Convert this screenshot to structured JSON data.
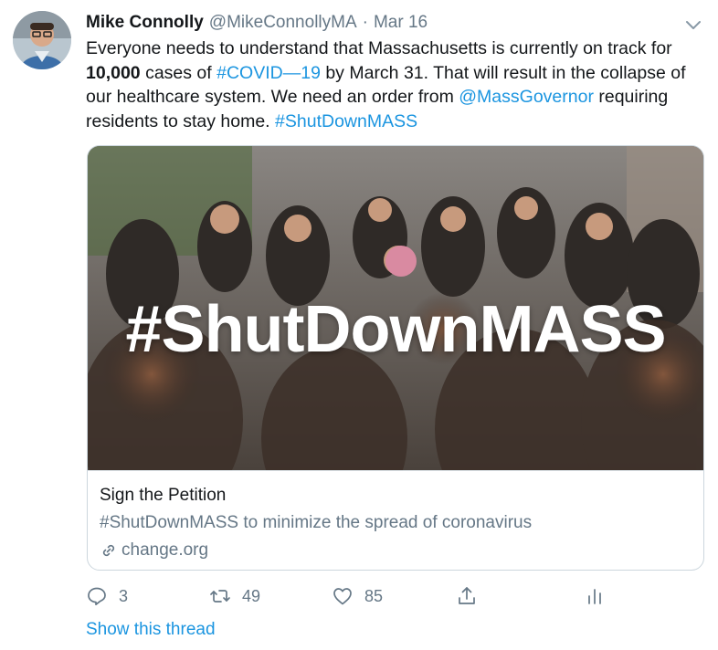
{
  "author": {
    "name": "Mike Connolly",
    "handle": "@MikeConnollyMA",
    "separator": "·",
    "date": "Mar 16",
    "avatar_icon": "avatar-photo"
  },
  "tweet": {
    "t1": "Everyone needs to understand that Massachusetts is currently on track for ",
    "bold": "10,000",
    "t2": " cases of ",
    "hashtag_covid": "#COVID—19",
    "t3": " by March 31. That will result in the collapse of our healthcare system. We need an order from ",
    "mention": "@MassGovernor",
    "t4": " requiring residents to stay home. ",
    "hashtag_shutdown": "#ShutDownMASS"
  },
  "card": {
    "image_overlay": "#ShutDownMASS",
    "title": "Sign the Petition",
    "description": "#ShutDownMASS to minimize the spread of coronavirus",
    "domain": "change.org",
    "domain_icon": "link-icon"
  },
  "actions": {
    "reply_count": "3",
    "retweet_count": "49",
    "like_count": "85",
    "icons": [
      "reply-icon",
      "retweet-icon",
      "like-icon",
      "share-icon",
      "analytics-icon"
    ]
  },
  "show_thread": "Show this thread",
  "colors": {
    "link": "#1b95e0",
    "secondary": "#657786",
    "text": "#14171a",
    "border": "#ccd6dd"
  }
}
